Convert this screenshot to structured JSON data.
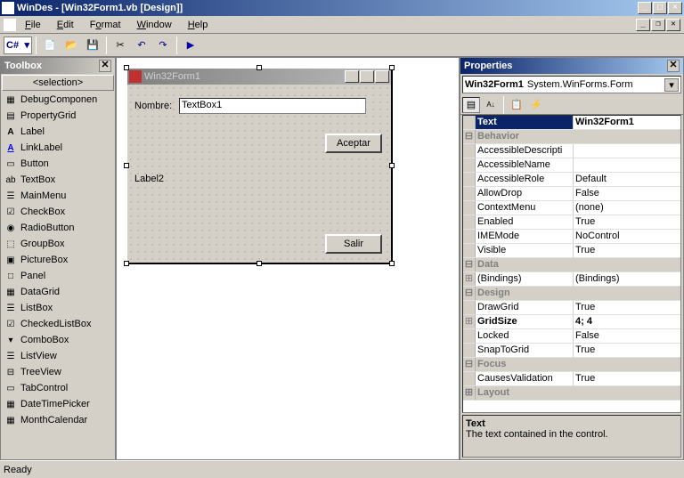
{
  "app": {
    "title": "WinDes - [Win32Form1.vb [Design]]"
  },
  "menu": {
    "file": "File",
    "edit": "Edit",
    "format": "Format",
    "window": "Window",
    "help": "Help"
  },
  "toolbar": {
    "lang": "C#"
  },
  "toolbox": {
    "title": "Toolbox",
    "category": "<selection>",
    "items": [
      {
        "icon": "▦",
        "label": "DebugComponen"
      },
      {
        "icon": "▤",
        "label": "PropertyGrid"
      },
      {
        "icon": "A",
        "label": "Label",
        "style": "bold"
      },
      {
        "icon": "A",
        "label": "LinkLabel",
        "style": "linkblue"
      },
      {
        "icon": "▭",
        "label": "Button"
      },
      {
        "icon": "ab",
        "label": "TextBox"
      },
      {
        "icon": "☰",
        "label": "MainMenu"
      },
      {
        "icon": "☑",
        "label": "CheckBox"
      },
      {
        "icon": "◉",
        "label": "RadioButton"
      },
      {
        "icon": "⬚",
        "label": "GroupBox"
      },
      {
        "icon": "▣",
        "label": "PictureBox"
      },
      {
        "icon": "□",
        "label": "Panel"
      },
      {
        "icon": "▦",
        "label": "DataGrid"
      },
      {
        "icon": "☰",
        "label": "ListBox"
      },
      {
        "icon": "☑",
        "label": "CheckedListBox"
      },
      {
        "icon": "▾",
        "label": "ComboBox"
      },
      {
        "icon": "☰",
        "label": "ListView"
      },
      {
        "icon": "⊟",
        "label": "TreeView"
      },
      {
        "icon": "▭",
        "label": "TabControl"
      },
      {
        "icon": "▦",
        "label": "DateTimePicker"
      },
      {
        "icon": "▦",
        "label": "MonthCalendar"
      }
    ]
  },
  "form": {
    "title": "Win32Form1",
    "label1": "Nombre:",
    "textbox1": "TextBox1",
    "button1": "Aceptar",
    "label2": "Label2",
    "button2": "Salir"
  },
  "properties": {
    "title": "Properties",
    "obj_name": "Win32Form1",
    "obj_type": "System.WinForms.Form",
    "rows": [
      {
        "type": "sel",
        "exp": "",
        "name": "Text",
        "val": "Win32Form1"
      },
      {
        "type": "cat",
        "exp": "⊟",
        "name": "Behavior",
        "val": ""
      },
      {
        "type": "",
        "exp": "",
        "name": "AccessibleDescripti",
        "val": ""
      },
      {
        "type": "",
        "exp": "",
        "name": "AccessibleName",
        "val": ""
      },
      {
        "type": "",
        "exp": "",
        "name": "AccessibleRole",
        "val": "Default"
      },
      {
        "type": "",
        "exp": "",
        "name": "AllowDrop",
        "val": "False"
      },
      {
        "type": "",
        "exp": "",
        "name": "ContextMenu",
        "val": "(none)"
      },
      {
        "type": "",
        "exp": "",
        "name": "Enabled",
        "val": "True"
      },
      {
        "type": "",
        "exp": "",
        "name": "IMEMode",
        "val": "NoControl"
      },
      {
        "type": "",
        "exp": "",
        "name": "Visible",
        "val": "True"
      },
      {
        "type": "cat",
        "exp": "⊟",
        "name": "Data",
        "val": ""
      },
      {
        "type": "",
        "exp": "⊞",
        "name": "(Bindings)",
        "val": "(Bindings)"
      },
      {
        "type": "cat",
        "exp": "⊟",
        "name": "Design",
        "val": ""
      },
      {
        "type": "",
        "exp": "",
        "name": "DrawGrid",
        "val": "True"
      },
      {
        "type": "bold",
        "exp": "⊞",
        "name": "GridSize",
        "val": "4; 4"
      },
      {
        "type": "",
        "exp": "",
        "name": "Locked",
        "val": "False"
      },
      {
        "type": "",
        "exp": "",
        "name": "SnapToGrid",
        "val": "True"
      },
      {
        "type": "cat",
        "exp": "⊟",
        "name": "Focus",
        "val": ""
      },
      {
        "type": "",
        "exp": "",
        "name": "CausesValidation",
        "val": "True"
      },
      {
        "type": "cat",
        "exp": "⊞",
        "name": "Layout",
        "val": ""
      }
    ],
    "desc_name": "Text",
    "desc_text": "The text contained in the control."
  },
  "status": "Ready"
}
